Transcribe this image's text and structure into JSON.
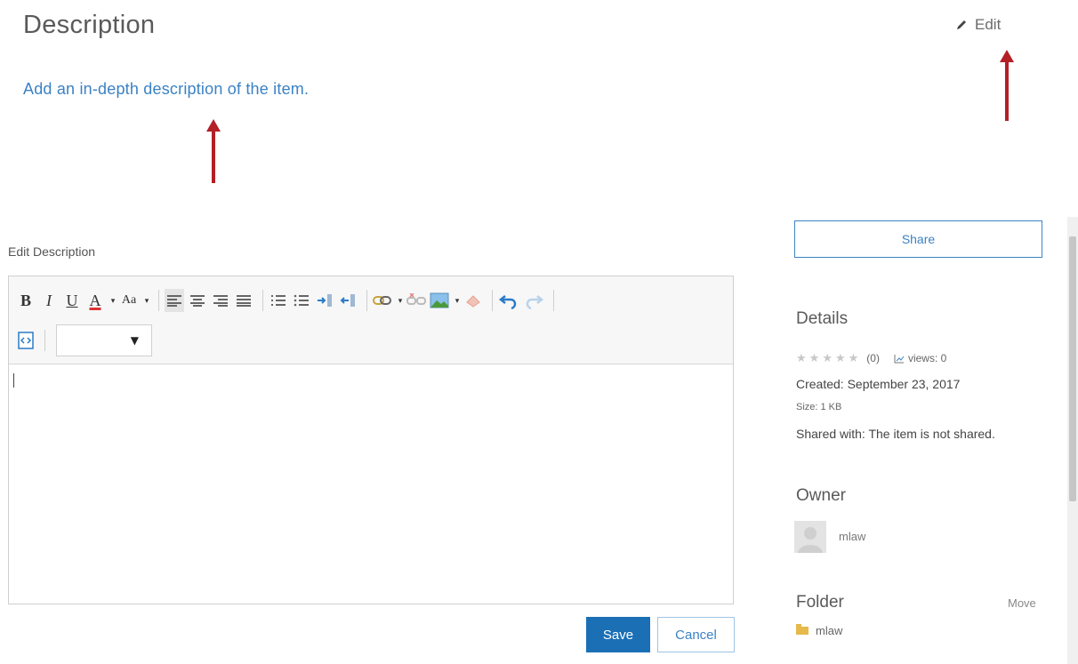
{
  "description": {
    "title": "Description",
    "edit_label": "Edit",
    "edit_icon": "pencil-icon",
    "add_link": "Add an in-depth description of the item."
  },
  "annotation": {
    "arrow_color": "#b32025"
  },
  "editor": {
    "label": "Edit Description",
    "toolbar": {
      "row1": [
        "bold",
        "italic",
        "underline",
        "font-color",
        "font-size",
        "align-left",
        "align-center",
        "align-right",
        "align-justify",
        "ordered-list",
        "unordered-list",
        "indent",
        "outdent",
        "link",
        "unlink",
        "insert-image",
        "remove-format",
        "undo",
        "redo"
      ],
      "row2": [
        "view-source",
        "format-select"
      ],
      "bold_glyph": "B",
      "italic_glyph": "I",
      "underline_glyph": "U",
      "font_color_glyph": "A",
      "font_size_glyph": "Aa",
      "dropdown_glyph": "▾",
      "select_caret": "▼"
    },
    "content": "",
    "save_label": "Save",
    "cancel_label": "Cancel"
  },
  "sidebar": {
    "share_label": "Share",
    "details": {
      "heading": "Details",
      "rating_count": "(0)",
      "views": "views: 0",
      "created": "Created: September 23, 2017",
      "size": "Size: 1 KB",
      "shared_with": "Shared with: The item is not shared."
    },
    "owner": {
      "heading": "Owner",
      "name": "mlaw"
    },
    "folder": {
      "heading": "Folder",
      "move_label": "Move",
      "name": "mlaw"
    }
  },
  "colors": {
    "accent": "#3b82c4",
    "primary_button": "#1b6fb5",
    "folder": "#e6b94a"
  }
}
